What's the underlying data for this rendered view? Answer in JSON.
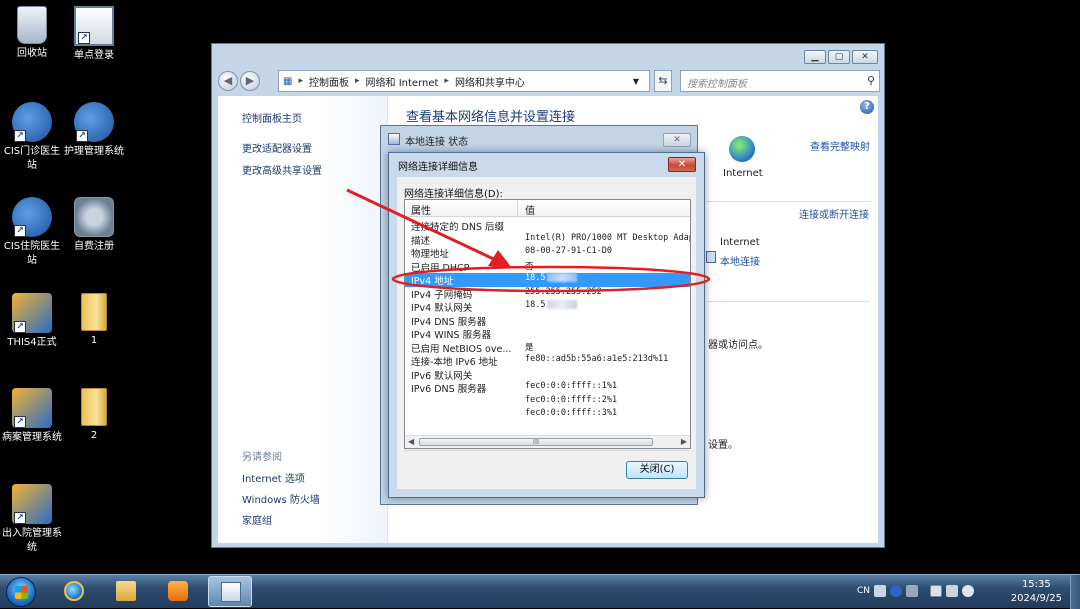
{
  "desktop": {
    "icons": [
      {
        "label": "回收站"
      },
      {
        "label": "单点登录"
      },
      {
        "label": "CIS门诊医生站"
      },
      {
        "label": "护理管理系统"
      },
      {
        "label": "CIS住院医生站"
      },
      {
        "label": "自费注册"
      },
      {
        "label": "THIS4正式"
      },
      {
        "label": "1"
      },
      {
        "label": "病案管理系统"
      },
      {
        "label": "2"
      },
      {
        "label": "出入院管理系统"
      }
    ]
  },
  "main_window": {
    "address": {
      "crumbs": [
        "控制面板",
        "网络和 Internet",
        "网络和共享中心"
      ]
    },
    "search_placeholder": "搜索控制面板",
    "sidebar": {
      "links": [
        "控制面板主页",
        "更改适配器设置",
        "更改高级共享设置"
      ],
      "see_also_header": "另请参阅",
      "see_also": [
        "Internet 选项",
        "Windows 防火墙",
        "家庭组"
      ]
    },
    "heading": "查看基本网络信息并设置连接",
    "full_map_link": "查看完整映射",
    "internet_label": "Internet",
    "connect_link": "连接或断开连接",
    "access_type_value": "Internet",
    "connection_link": "本地连接",
    "text_fragment_1": "器或访问点。",
    "text_fragment_2": "设置。"
  },
  "status_dialog": {
    "title": "本地连接 状态"
  },
  "details_dialog": {
    "title": "网络连接详细信息",
    "list_label": "网络连接详细信息(D):",
    "columns": [
      "属性",
      "值"
    ],
    "rows": [
      {
        "prop": "连接特定的 DNS 后缀",
        "value": ""
      },
      {
        "prop": "描述",
        "value": "Intel(R) PRO/1000 MT Desktop Adap"
      },
      {
        "prop": "物理地址",
        "value": "08-00-27-91-C1-D0"
      },
      {
        "prop": "已启用 DHCP",
        "value": "否"
      },
      {
        "prop": "IPv4 地址",
        "value": "18.5"
      },
      {
        "prop": "IPv4 子网掩码",
        "value": "255.255.255.252"
      },
      {
        "prop": "IPv4 默认网关",
        "value": "18.5"
      },
      {
        "prop": "IPv4 DNS 服务器",
        "value": ""
      },
      {
        "prop": "IPv4 WINS 服务器",
        "value": ""
      },
      {
        "prop": "已启用 NetBIOS ove...",
        "value": "是"
      },
      {
        "prop": "连接-本地 IPv6 地址",
        "value": "fe80::ad5b:55a6:a1e5:213d%11"
      },
      {
        "prop": "IPv6 默认网关",
        "value": ""
      },
      {
        "prop": "IPv6 DNS 服务器",
        "value": "fec0:0:0:ffff::1%1"
      },
      {
        "prop": "",
        "value": "fec0:0:0:ffff::2%1"
      },
      {
        "prop": "",
        "value": "fec0:0:0:ffff::3%1"
      }
    ],
    "selected_row": 4,
    "blurred_rows": [
      4,
      6
    ],
    "scroll_grip": "III",
    "close_button": "关闭(C)"
  },
  "taskbar": {
    "language": "CN",
    "time": "15:35",
    "date": "2024/9/25"
  },
  "annotation_color": "#e02020"
}
